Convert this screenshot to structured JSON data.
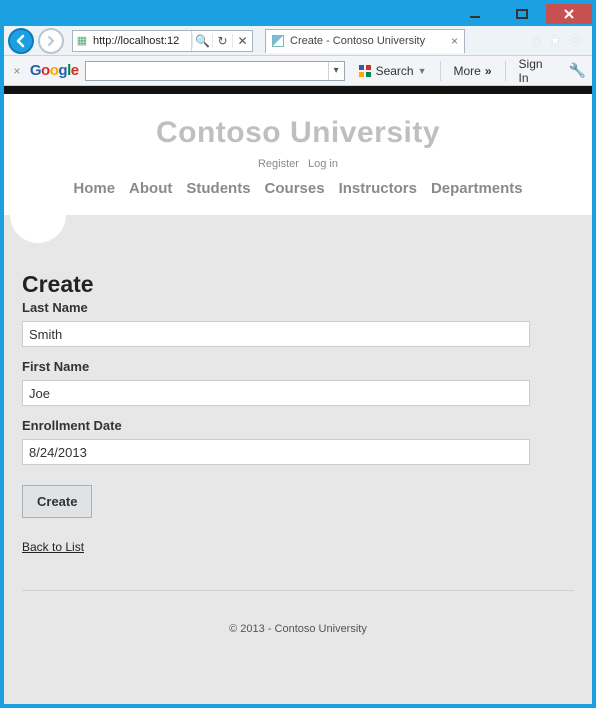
{
  "window": {
    "url": "http://localhost:12",
    "tab_title": "Create - Contoso University"
  },
  "google_toolbar": {
    "logo": "Google",
    "search_label": "Search",
    "more_label": "More",
    "signin_label": "Sign In"
  },
  "site": {
    "title": "Contoso University",
    "auth": {
      "register": "Register",
      "login": "Log in"
    },
    "nav": {
      "home": "Home",
      "about": "About",
      "students": "Students",
      "courses": "Courses",
      "instructors": "Instructors",
      "departments": "Departments"
    }
  },
  "form": {
    "heading": "Create",
    "last_name_label": "Last Name",
    "last_name_value": "Smith",
    "first_name_label": "First Name",
    "first_name_value": "Joe",
    "enroll_label": "Enrollment Date",
    "enroll_value": "8/24/2013",
    "submit_label": "Create",
    "back_label": "Back to List"
  },
  "footer": {
    "text": "© 2013 - Contoso University"
  }
}
